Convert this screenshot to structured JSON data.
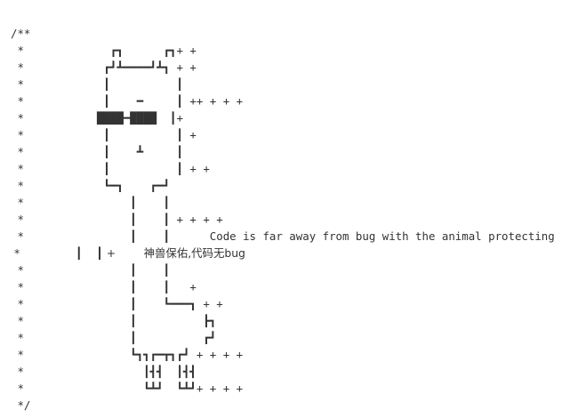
{
  "code_snippet": {
    "language": "text",
    "lines": [
      "/**",
      " *             ┏┓      ┏┓+ +",
      " *            ┏┛┻━━━━┛┻┓ + +",
      " *            ┃          ┃",
      " *            ┃    ━     ┃ ++ + + +",
      " *           ████━████  ┃+",
      " *            ┃          ┃ +",
      " *            ┃    ┻     ┃",
      " *            ┃          ┃ + +",
      " *            ┗━┓    ┏━┛",
      " *                ┃    ┃",
      " *                ┃    ┃ + + + +",
      " *                ┃    ┃      Code is far away from bug with the animal protecting",
      " *                ┃    ┃ +        神兽保佑,代码无bug",
      " *                ┃    ┃",
      " *                ┃    ┃   +",
      " *                ┃    ┗━━━┓ + +",
      " *                ┃          ┣┓",
      " *                ┃          ┏┛",
      " *                ┗┓┓┏━┳┓┏┛ + + + +",
      " *                  ┃┫┫  ┃┫┫",
      " *                  ┗┻┛  ┗┻┛+ + + +",
      " */"
    ]
  }
}
